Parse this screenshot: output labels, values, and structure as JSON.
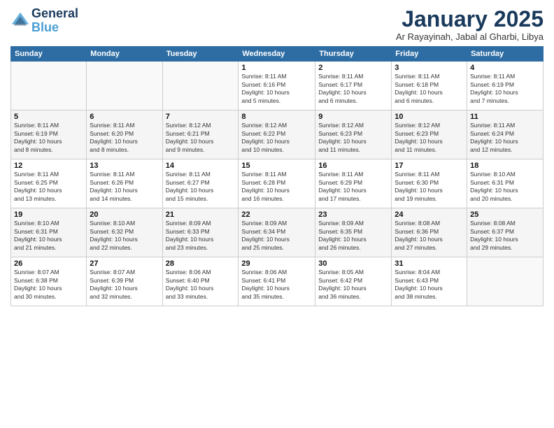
{
  "header": {
    "logo_line1": "General",
    "logo_line2": "Blue",
    "month_title": "January 2025",
    "subtitle": "Ar Rayayinah, Jabal al Gharbi, Libya"
  },
  "weekdays": [
    "Sunday",
    "Monday",
    "Tuesday",
    "Wednesday",
    "Thursday",
    "Friday",
    "Saturday"
  ],
  "weeks": [
    [
      {
        "day": "",
        "info": ""
      },
      {
        "day": "",
        "info": ""
      },
      {
        "day": "",
        "info": ""
      },
      {
        "day": "1",
        "info": "Sunrise: 8:11 AM\nSunset: 6:16 PM\nDaylight: 10 hours\nand 5 minutes."
      },
      {
        "day": "2",
        "info": "Sunrise: 8:11 AM\nSunset: 6:17 PM\nDaylight: 10 hours\nand 6 minutes."
      },
      {
        "day": "3",
        "info": "Sunrise: 8:11 AM\nSunset: 6:18 PM\nDaylight: 10 hours\nand 6 minutes."
      },
      {
        "day": "4",
        "info": "Sunrise: 8:11 AM\nSunset: 6:19 PM\nDaylight: 10 hours\nand 7 minutes."
      }
    ],
    [
      {
        "day": "5",
        "info": "Sunrise: 8:11 AM\nSunset: 6:19 PM\nDaylight: 10 hours\nand 8 minutes."
      },
      {
        "day": "6",
        "info": "Sunrise: 8:11 AM\nSunset: 6:20 PM\nDaylight: 10 hours\nand 8 minutes."
      },
      {
        "day": "7",
        "info": "Sunrise: 8:12 AM\nSunset: 6:21 PM\nDaylight: 10 hours\nand 9 minutes."
      },
      {
        "day": "8",
        "info": "Sunrise: 8:12 AM\nSunset: 6:22 PM\nDaylight: 10 hours\nand 10 minutes."
      },
      {
        "day": "9",
        "info": "Sunrise: 8:12 AM\nSunset: 6:23 PM\nDaylight: 10 hours\nand 11 minutes."
      },
      {
        "day": "10",
        "info": "Sunrise: 8:12 AM\nSunset: 6:23 PM\nDaylight: 10 hours\nand 11 minutes."
      },
      {
        "day": "11",
        "info": "Sunrise: 8:11 AM\nSunset: 6:24 PM\nDaylight: 10 hours\nand 12 minutes."
      }
    ],
    [
      {
        "day": "12",
        "info": "Sunrise: 8:11 AM\nSunset: 6:25 PM\nDaylight: 10 hours\nand 13 minutes."
      },
      {
        "day": "13",
        "info": "Sunrise: 8:11 AM\nSunset: 6:26 PM\nDaylight: 10 hours\nand 14 minutes."
      },
      {
        "day": "14",
        "info": "Sunrise: 8:11 AM\nSunset: 6:27 PM\nDaylight: 10 hours\nand 15 minutes."
      },
      {
        "day": "15",
        "info": "Sunrise: 8:11 AM\nSunset: 6:28 PM\nDaylight: 10 hours\nand 16 minutes."
      },
      {
        "day": "16",
        "info": "Sunrise: 8:11 AM\nSunset: 6:29 PM\nDaylight: 10 hours\nand 17 minutes."
      },
      {
        "day": "17",
        "info": "Sunrise: 8:11 AM\nSunset: 6:30 PM\nDaylight: 10 hours\nand 19 minutes."
      },
      {
        "day": "18",
        "info": "Sunrise: 8:10 AM\nSunset: 6:31 PM\nDaylight: 10 hours\nand 20 minutes."
      }
    ],
    [
      {
        "day": "19",
        "info": "Sunrise: 8:10 AM\nSunset: 6:31 PM\nDaylight: 10 hours\nand 21 minutes."
      },
      {
        "day": "20",
        "info": "Sunrise: 8:10 AM\nSunset: 6:32 PM\nDaylight: 10 hours\nand 22 minutes."
      },
      {
        "day": "21",
        "info": "Sunrise: 8:09 AM\nSunset: 6:33 PM\nDaylight: 10 hours\nand 23 minutes."
      },
      {
        "day": "22",
        "info": "Sunrise: 8:09 AM\nSunset: 6:34 PM\nDaylight: 10 hours\nand 25 minutes."
      },
      {
        "day": "23",
        "info": "Sunrise: 8:09 AM\nSunset: 6:35 PM\nDaylight: 10 hours\nand 26 minutes."
      },
      {
        "day": "24",
        "info": "Sunrise: 8:08 AM\nSunset: 6:36 PM\nDaylight: 10 hours\nand 27 minutes."
      },
      {
        "day": "25",
        "info": "Sunrise: 8:08 AM\nSunset: 6:37 PM\nDaylight: 10 hours\nand 29 minutes."
      }
    ],
    [
      {
        "day": "26",
        "info": "Sunrise: 8:07 AM\nSunset: 6:38 PM\nDaylight: 10 hours\nand 30 minutes."
      },
      {
        "day": "27",
        "info": "Sunrise: 8:07 AM\nSunset: 6:39 PM\nDaylight: 10 hours\nand 32 minutes."
      },
      {
        "day": "28",
        "info": "Sunrise: 8:06 AM\nSunset: 6:40 PM\nDaylight: 10 hours\nand 33 minutes."
      },
      {
        "day": "29",
        "info": "Sunrise: 8:06 AM\nSunset: 6:41 PM\nDaylight: 10 hours\nand 35 minutes."
      },
      {
        "day": "30",
        "info": "Sunrise: 8:05 AM\nSunset: 6:42 PM\nDaylight: 10 hours\nand 36 minutes."
      },
      {
        "day": "31",
        "info": "Sunrise: 8:04 AM\nSunset: 6:43 PM\nDaylight: 10 hours\nand 38 minutes."
      },
      {
        "day": "",
        "info": ""
      }
    ]
  ]
}
